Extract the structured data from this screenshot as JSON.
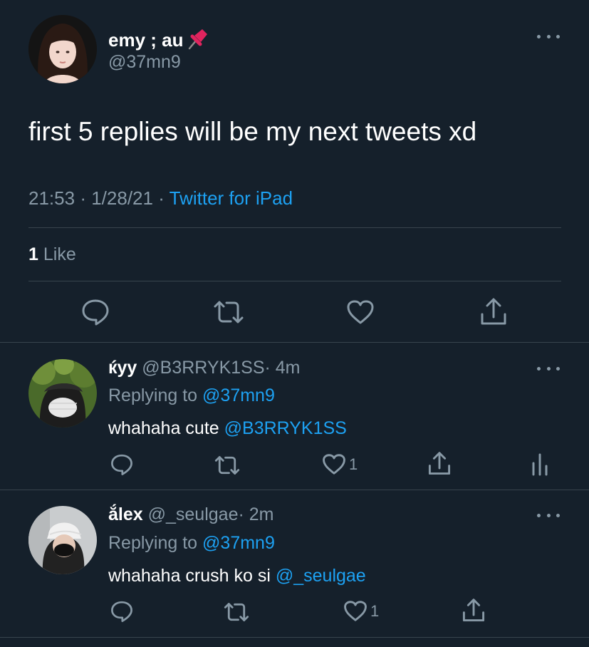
{
  "main_tweet": {
    "display_name": "emy ; au",
    "handle": "@37mn9",
    "text": "first 5 replies will be my next tweets xd",
    "time": "21:53",
    "sep1": "·",
    "date": "1/28/21",
    "sep2": "·",
    "source": "Twitter for iPad",
    "likes_count": "1",
    "likes_label": "Like",
    "icons": [
      "reply-icon",
      "retweet-icon",
      "like-icon",
      "share-icon"
    ]
  },
  "replies": [
    {
      "display_name": "ќуу",
      "handle": "@B3RRYK1SS",
      "time_sep": "·",
      "time": "4m",
      "replying_label": "Replying to",
      "replying_to": "@37mn9",
      "text": "whahaha cute",
      "mention": "@B3RRYK1SS",
      "like_count": "1"
    },
    {
      "display_name": "ắlex",
      "handle": "@_seulgae",
      "time_sep": "·",
      "time": "2m",
      "replying_label": "Replying to",
      "replying_to": "@37mn9",
      "text": "whahaha crush ko si",
      "mention": "@_seulgae",
      "like_count": "1"
    }
  ],
  "colors": {
    "background": "#15202b",
    "text": "#ffffff",
    "muted": "#8899a6",
    "link": "#1da1f2",
    "divider": "#38444d"
  }
}
